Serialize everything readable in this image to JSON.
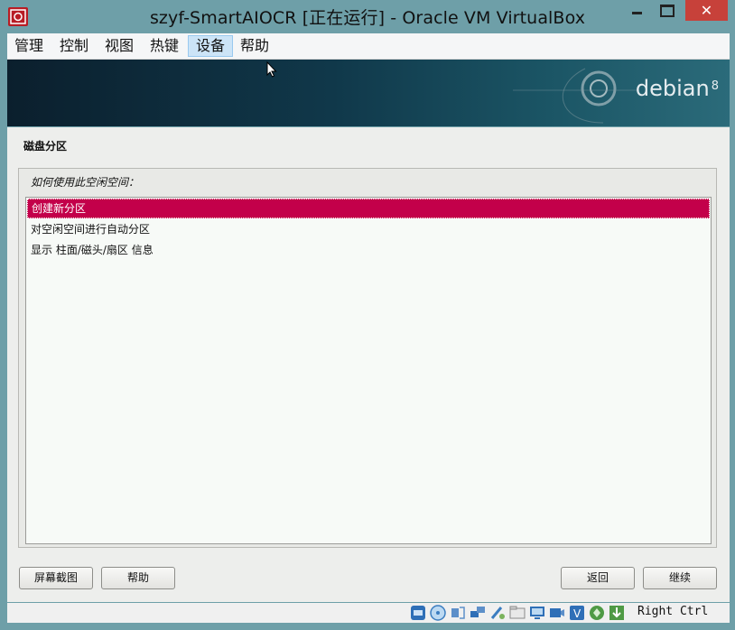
{
  "window": {
    "title": "szyf-SmartAIOCR [正在运行] - Oracle VM VirtualBox",
    "controls": {
      "minimize": "—",
      "maximize": "□",
      "close": "✕"
    }
  },
  "menu": {
    "items": [
      {
        "label": "管理"
      },
      {
        "label": "控制"
      },
      {
        "label": "视图"
      },
      {
        "label": "热键"
      },
      {
        "label": "设备",
        "active": true
      },
      {
        "label": "帮助"
      }
    ]
  },
  "banner": {
    "logo_text": "debian",
    "logo_version": "8"
  },
  "installer": {
    "section_title": "磁盘分区",
    "question": "如何使用此空闲空间：",
    "options": [
      {
        "label": "创建新分区",
        "selected": true
      },
      {
        "label": "对空闲空间进行自动分区",
        "selected": false
      },
      {
        "label": "显示 柱面/磁头/扇区 信息",
        "selected": false
      }
    ],
    "buttons": {
      "screenshot": "屏幕截图",
      "help": "帮助",
      "back": "返回",
      "continue": "继续"
    }
  },
  "statusbar": {
    "icons": [
      "hard-disk-icon",
      "optical-drive-icon",
      "audio-icon",
      "network-icon",
      "usb-icon",
      "shared-folders-icon",
      "display-icon",
      "video-capture-icon",
      "virtualization-icon",
      "mouse-integration-icon",
      "download-icon"
    ],
    "host_key": "Right Ctrl"
  }
}
